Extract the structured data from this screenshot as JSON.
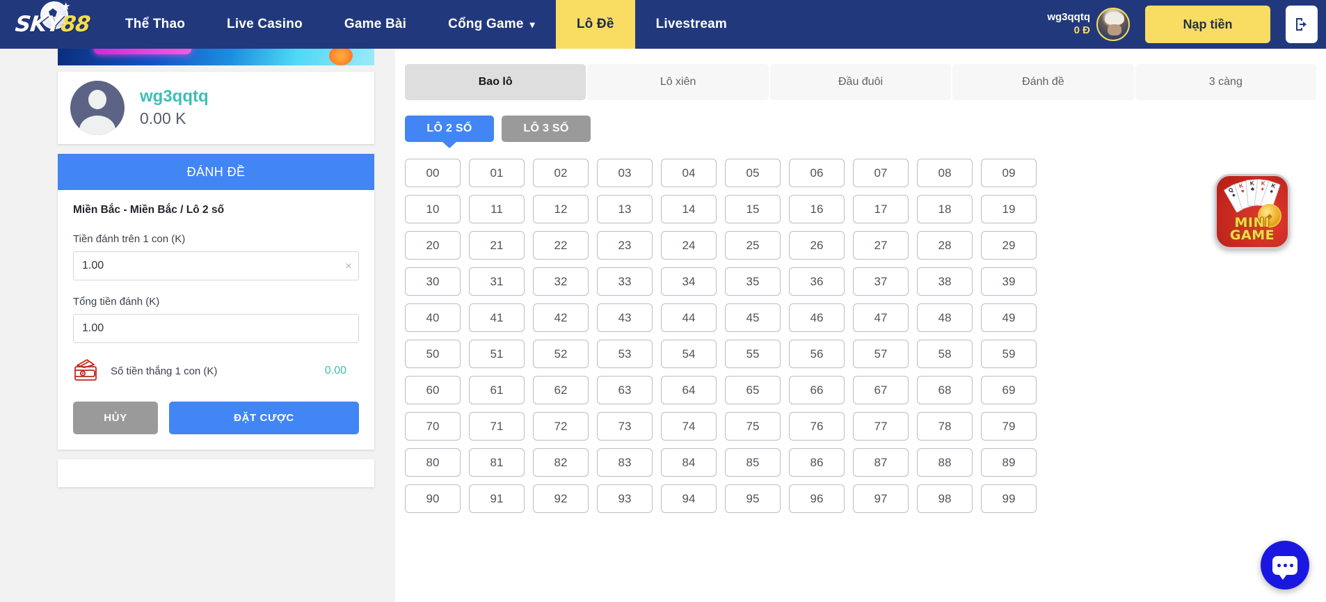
{
  "header": {
    "logo": {
      "primary": "SKY",
      "accent": "88",
      "icon": "sky88-logo"
    },
    "nav": [
      {
        "label": "Thể Thao",
        "active": false,
        "caret": false
      },
      {
        "label": "Live Casino",
        "active": false,
        "caret": false
      },
      {
        "label": "Game Bài",
        "active": false,
        "caret": false
      },
      {
        "label": "Cổng Game",
        "active": false,
        "caret": true,
        "caret_glyph": "⌄"
      },
      {
        "label": "Lô Đề",
        "active": true,
        "caret": false
      },
      {
        "label": "Livestream",
        "active": false,
        "caret": false
      }
    ],
    "user": {
      "name": "wg3qqtq",
      "balance": "0 Đ"
    },
    "deposit_label": "Nạp tiền",
    "logout_icon": "logout-icon",
    "accent_color": "#f8dd62",
    "bg_color": "#21397c"
  },
  "sidebar": {
    "profile": {
      "name": "wg3qqtq",
      "balance": "0.00 K",
      "avatar_icon": "user-avatar-icon"
    },
    "bet_panel": {
      "header": "ĐÁNH ĐỀ",
      "title": "Miền Bắc - Miền Bắc / Lô 2 số",
      "fields": [
        {
          "label": "Tiền đánh trên 1 con (K)",
          "value": "1.00",
          "clearable": true,
          "clear_glyph": "×"
        },
        {
          "label": "Tổng tiền đánh (K)",
          "value": "1.00",
          "clearable": false
        }
      ],
      "win": {
        "icon": "wallet-money-icon",
        "label": "Số tiền thắng 1 con (K)",
        "value": "0.00"
      },
      "cancel_label": "HỦY",
      "submit_label": "ĐẶT CƯỢC"
    }
  },
  "main": {
    "tabs": [
      {
        "label": "Bao lô",
        "active": true
      },
      {
        "label": "Lô xiên",
        "active": false
      },
      {
        "label": "Đầu đuôi",
        "active": false
      },
      {
        "label": "Đánh đề",
        "active": false
      },
      {
        "label": "3 càng",
        "active": false
      }
    ],
    "subtabs": [
      {
        "label": "LÔ 2 SỐ",
        "selected": true
      },
      {
        "label": "LÔ 3 SỐ",
        "selected": false
      }
    ],
    "numbers": [
      "00",
      "01",
      "02",
      "03",
      "04",
      "05",
      "06",
      "07",
      "08",
      "09",
      "10",
      "11",
      "12",
      "13",
      "14",
      "15",
      "16",
      "17",
      "18",
      "19",
      "20",
      "21",
      "22",
      "23",
      "24",
      "25",
      "26",
      "27",
      "28",
      "29",
      "30",
      "31",
      "32",
      "33",
      "34",
      "35",
      "36",
      "37",
      "38",
      "39",
      "40",
      "41",
      "42",
      "43",
      "44",
      "45",
      "46",
      "47",
      "48",
      "49",
      "50",
      "51",
      "52",
      "53",
      "54",
      "55",
      "56",
      "57",
      "58",
      "59",
      "60",
      "61",
      "62",
      "63",
      "64",
      "65",
      "66",
      "67",
      "68",
      "69",
      "70",
      "71",
      "72",
      "73",
      "74",
      "75",
      "76",
      "77",
      "78",
      "79",
      "80",
      "81",
      "82",
      "83",
      "84",
      "85",
      "86",
      "87",
      "88",
      "89",
      "90",
      "91",
      "92",
      "93",
      "94",
      "95",
      "96",
      "97",
      "98",
      "99"
    ]
  },
  "widgets": {
    "minigame": {
      "line1": "MINI",
      "line2": "GAME",
      "icon": "minigame-cards-icon",
      "cards": [
        {
          "rank": "Q",
          "suit": "♠",
          "red": false
        },
        {
          "rank": "K",
          "suit": "♥",
          "red": true
        },
        {
          "rank": "K",
          "suit": "♣",
          "red": false
        },
        {
          "rank": "K",
          "suit": "♦",
          "red": true
        },
        {
          "rank": "K",
          "suit": "♠",
          "red": false
        }
      ]
    },
    "chat": {
      "icon": "chat-bubble-icon",
      "color": "#1a18e0"
    }
  }
}
